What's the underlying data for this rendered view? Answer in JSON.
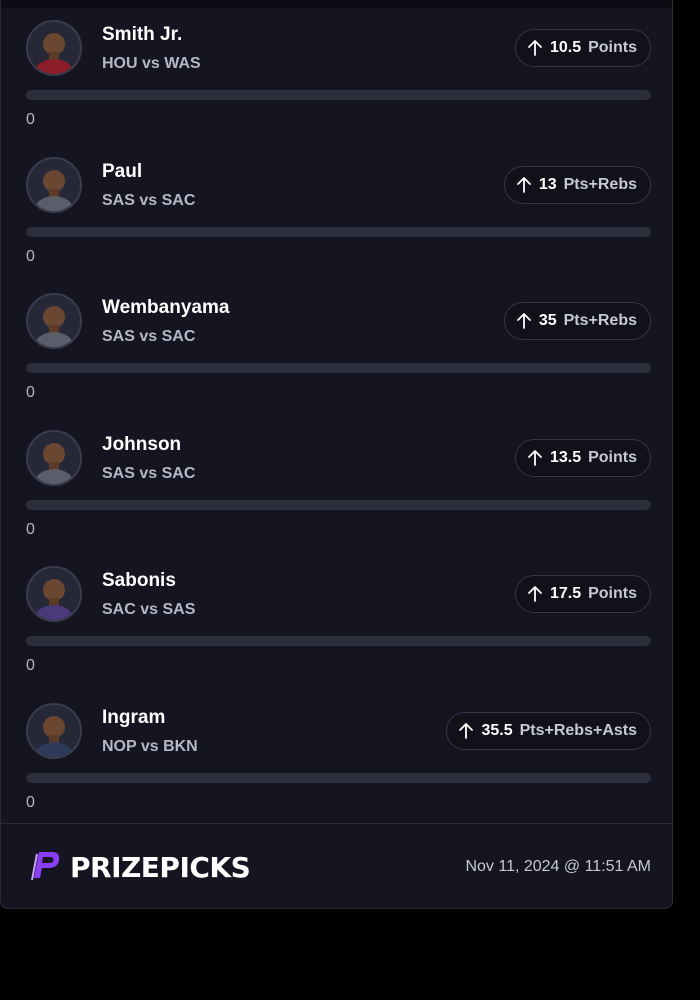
{
  "picks": [
    {
      "name": "Smith Jr.",
      "matchup": "HOU vs WAS",
      "direction": "over",
      "line": "10.5",
      "stat": "Points",
      "progress_value": "0",
      "progress": 0,
      "jersey_color": "#8b1e2a"
    },
    {
      "name": "Paul",
      "matchup": "SAS vs SAC",
      "direction": "over",
      "line": "13",
      "stat": "Pts+Rebs",
      "progress_value": "0",
      "progress": 0,
      "jersey_color": "#5a5e6a"
    },
    {
      "name": "Wembanyama",
      "matchup": "SAS vs SAC",
      "direction": "over",
      "line": "35",
      "stat": "Pts+Rebs",
      "progress_value": "0",
      "progress": 0,
      "jersey_color": "#5a5e6a"
    },
    {
      "name": "Johnson",
      "matchup": "SAS vs SAC",
      "direction": "over",
      "line": "13.5",
      "stat": "Points",
      "progress_value": "0",
      "progress": 0,
      "jersey_color": "#5a5e6a"
    },
    {
      "name": "Sabonis",
      "matchup": "SAC vs SAS",
      "direction": "over",
      "line": "17.5",
      "stat": "Points",
      "progress_value": "0",
      "progress": 0,
      "jersey_color": "#4b3a7a"
    },
    {
      "name": "Ingram",
      "matchup": "NOP vs BKN",
      "direction": "over",
      "line": "35.5",
      "stat": "Pts+Rebs+Asts",
      "progress_value": "0",
      "progress": 0,
      "jersey_color": "#2e3a5a"
    }
  ],
  "footer": {
    "brand": "PRIZEPICKS",
    "timestamp": "Nov 11, 2024 @ 11:51 AM"
  },
  "icons": {
    "direction": "arrow-up-icon",
    "brand": "prizepicks-logo-icon"
  },
  "colors": {
    "background": "#141521",
    "brand_purple": "#7f3cf5",
    "track": "#2c2e3c"
  }
}
